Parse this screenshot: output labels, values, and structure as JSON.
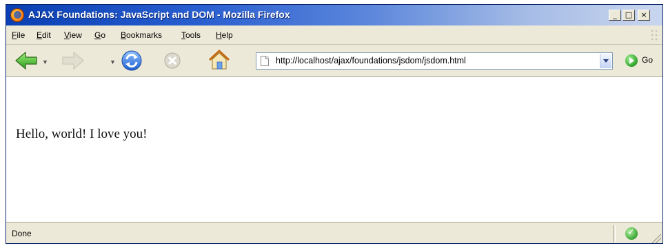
{
  "window": {
    "title": "AJAX Foundations: JavaScript and DOM - Mozilla Firefox"
  },
  "window_controls": {
    "minimize": "_",
    "maximize": "□",
    "close": "×"
  },
  "menu": {
    "items": [
      {
        "label": "File",
        "mnemonic": "F",
        "rest": "ile"
      },
      {
        "label": "Edit",
        "mnemonic": "E",
        "rest": "dit"
      },
      {
        "label": "View",
        "mnemonic": "V",
        "rest": "iew"
      },
      {
        "label": "Go",
        "mnemonic": "G",
        "rest": "o"
      },
      {
        "label": "Bookmarks",
        "mnemonic": "B",
        "rest": "ookmarks"
      },
      {
        "label": "Tools",
        "mnemonic": "T",
        "rest": "ools"
      },
      {
        "label": "Help",
        "mnemonic": "H",
        "rest": "elp"
      }
    ]
  },
  "toolbar": {
    "url": "http://localhost/ajax/foundations/jsdom/jsdom.html",
    "go_label": "Go"
  },
  "content": {
    "text": "Hello, world! I love you!"
  },
  "status": {
    "text": "Done"
  },
  "colors": {
    "titlebar_start": "#0a3fb3",
    "chrome": "#ece9d8",
    "go_green": "#2fa12a"
  }
}
